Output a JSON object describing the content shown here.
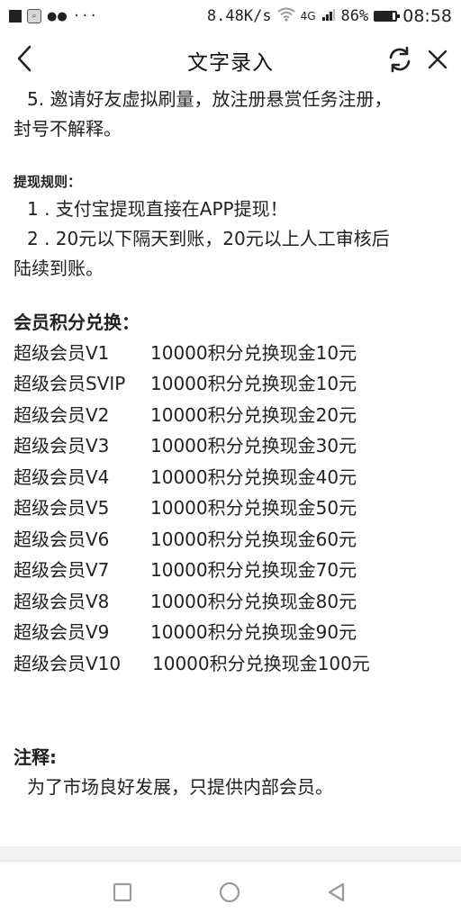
{
  "status_bar": {
    "dots": "···",
    "speed": "8.48K/s",
    "signal_label": "4G",
    "battery_percent": "86%",
    "battery_level": 0.86,
    "time": "08:58",
    "icons": [
      "square-notification-icon",
      "search-app-icon",
      "wechat-icon",
      "wifi-icon",
      "signal-icon",
      "battery-icon"
    ]
  },
  "header": {
    "title": "文字录入",
    "icons": {
      "back": "chevron-left-icon",
      "refresh": "refresh-icon",
      "close": "close-icon"
    }
  },
  "content": {
    "rule5_line1": "5. 邀请好友虚拟刷量，放注册悬赏任务注册，",
    "rule5_line2": "封号不解释。",
    "withdraw_heading": "提现规则：",
    "withdraw_rule1": "1 . 支付宝提现直接在APP提现！",
    "withdraw_rule2_line1": "2 . 20元以下隔天到账，20元以上人工审核后",
    "withdraw_rule2_line2": "陆续到账。",
    "exchange_heading": "会员积分兑换：",
    "members": [
      {
        "name": "超级会员V1",
        "exchange": "10000积分兑换现金10元"
      },
      {
        "name": "超级会员SVIP",
        "exchange": "10000积分兑换现金10元"
      },
      {
        "name": "超级会员V2",
        "exchange": "10000积分兑换现金20元"
      },
      {
        "name": "超级会员V3",
        "exchange": "10000积分兑换现金30元"
      },
      {
        "name": "超级会员V4",
        "exchange": "10000积分兑换现金40元"
      },
      {
        "name": "超级会员V5",
        "exchange": "10000积分兑换现金50元"
      },
      {
        "name": "超级会员V6",
        "exchange": "10000积分兑换现金60元"
      },
      {
        "name": "超级会员V7",
        "exchange": "10000积分兑换现金70元"
      },
      {
        "name": "超级会员V8",
        "exchange": "10000积分兑换现金80元"
      },
      {
        "name": "超级会员V9",
        "exchange": "10000积分兑换现金90元"
      },
      {
        "name": "超级会员V10",
        "exchange": "10000积分兑换现金100元"
      }
    ],
    "note_heading": "注释:",
    "note_text": "为了市场良好发展，只提供内部会员。"
  },
  "nav": {
    "icons": {
      "recent": "square-recent-apps-icon",
      "home": "circle-home-icon",
      "back": "triangle-back-icon"
    }
  },
  "colors": {
    "text": "#222222",
    "icon": "#222222",
    "nav_icon": "#9a9a9a",
    "divider": "#f2f2f2"
  }
}
